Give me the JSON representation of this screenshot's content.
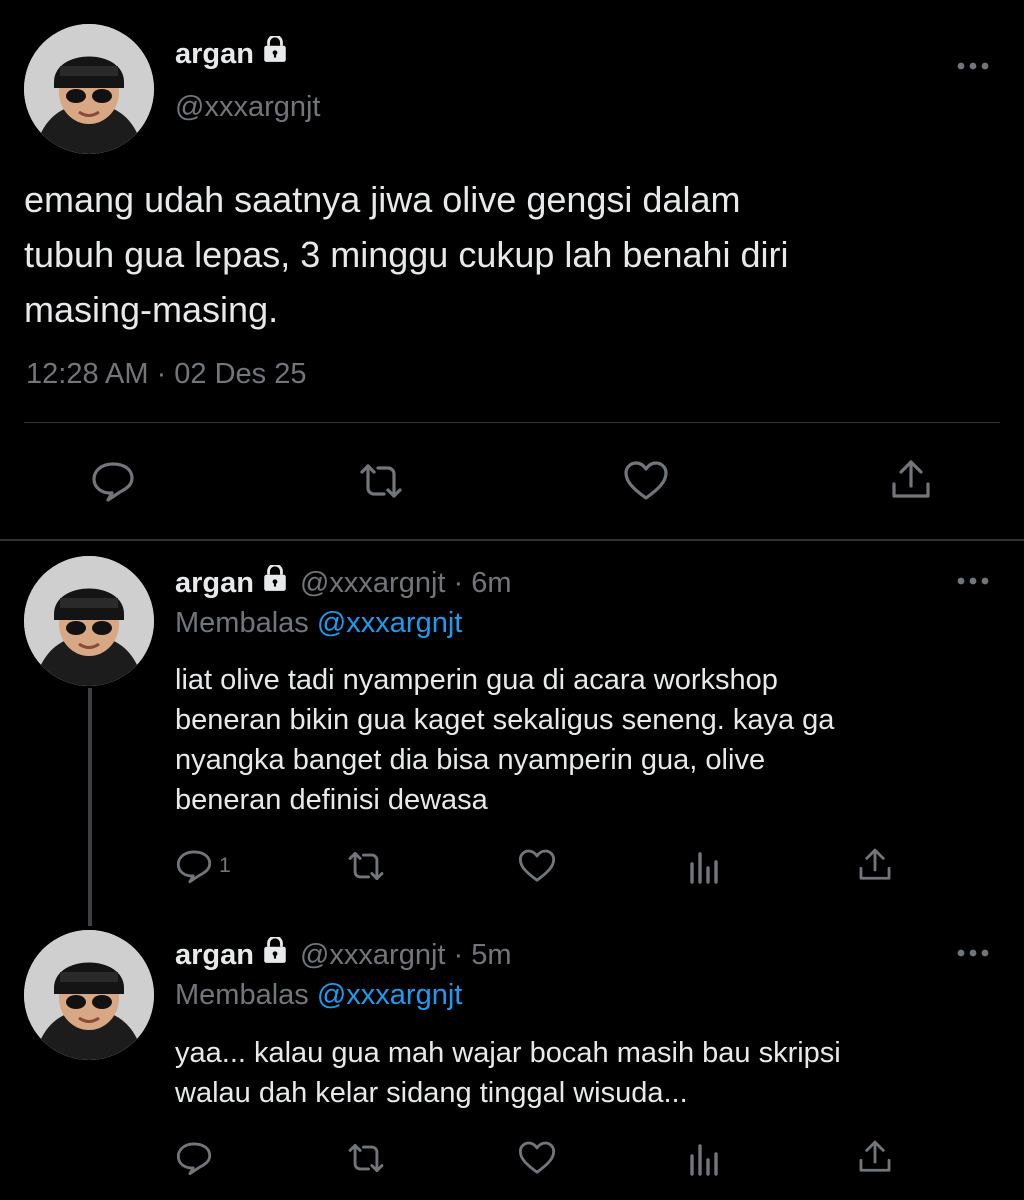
{
  "main_tweet": {
    "display_name": "argan",
    "handle": "@xxxargnjt",
    "text_lines": [
      "emang udah saatnya jiwa olive gengsi dalam",
      "tubuh gua lepas, 3 minggu cukup lah benahi diri",
      "masing-masing."
    ],
    "timestamp": "12:28 AM · 02 Des 25"
  },
  "replies": [
    {
      "display_name": "argan",
      "handle_time": "@xxxargnjt · 6m",
      "replying_prefix": "Membalas",
      "replying_handle": "@xxxargnjt",
      "text_lines": [
        "liat olive tadi nyamperin gua di acara workshop",
        "beneran bikin gua kaget sekaligus seneng. kaya ga",
        "nyangka banget dia bisa nyamperin gua, olive",
        "beneran definisi dewasa"
      ],
      "reply_count": "1"
    },
    {
      "display_name": "argan",
      "handle_time": "@xxxargnjt · 5m",
      "replying_prefix": "Membalas",
      "replying_handle": "@xxxargnjt",
      "text_lines": [
        "yaa... kalau gua mah wajar bocah masih bau skripsi",
        "walau dah kelar sidang tinggal wisuda..."
      ],
      "reply_count": ""
    }
  ],
  "icons": {
    "lock": "lock-icon",
    "more": "more-icon",
    "reply": "reply-icon",
    "retweet": "retweet-icon",
    "like": "like-icon",
    "share": "share-icon",
    "views": "views-icon"
  },
  "colors": {
    "background": "#000000",
    "text": "#e7e9ea",
    "muted": "#71767b",
    "accent": "#1d9bf0",
    "divider": "#2f3336"
  }
}
